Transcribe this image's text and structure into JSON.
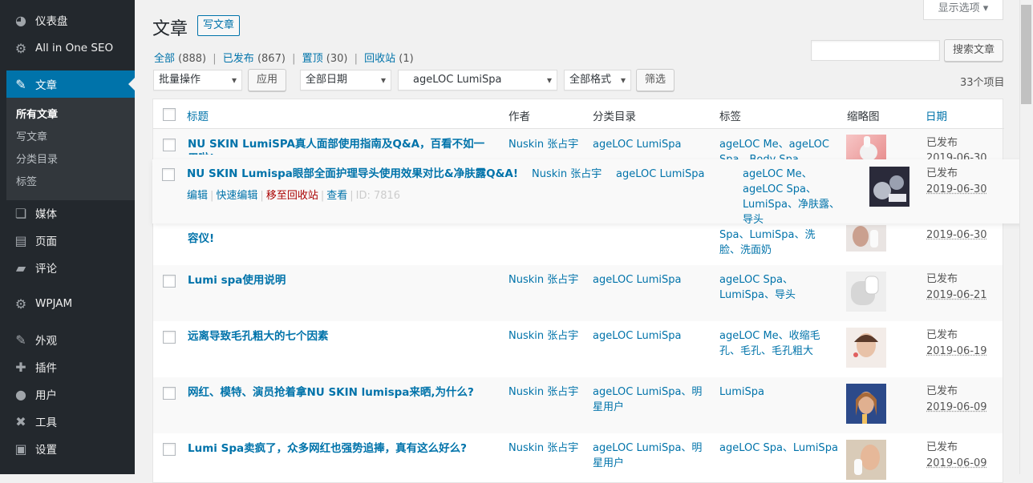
{
  "sidebar": {
    "items": [
      {
        "name": "dashboard",
        "label": "仪表盘",
        "icon": "gauge-icon",
        "glyph": "◕"
      },
      {
        "name": "seo",
        "label": "All in One SEO",
        "icon": "gear-icon",
        "glyph": "⚙"
      },
      {
        "name": "posts",
        "label": "文章",
        "icon": "pin-icon",
        "glyph": "✎"
      },
      {
        "name": "media",
        "label": "媒体",
        "icon": "media-icon",
        "glyph": "❏"
      },
      {
        "name": "pages",
        "label": "页面",
        "icon": "page-icon",
        "glyph": "▤"
      },
      {
        "name": "comments",
        "label": "评论",
        "icon": "comment-icon",
        "glyph": "▰"
      },
      {
        "name": "wpjam",
        "label": "WPJAM",
        "icon": "wpjam-icon",
        "glyph": "⚙"
      },
      {
        "name": "appearance",
        "label": "外观",
        "icon": "brush-icon",
        "glyph": "✎"
      },
      {
        "name": "plugins",
        "label": "插件",
        "icon": "plugin-icon",
        "glyph": "✚"
      },
      {
        "name": "users",
        "label": "用户",
        "icon": "user-icon",
        "glyph": "●"
      },
      {
        "name": "tools",
        "label": "工具",
        "icon": "wrench-icon",
        "glyph": "✖"
      },
      {
        "name": "settings",
        "label": "设置",
        "icon": "settings-icon",
        "glyph": "▣"
      }
    ],
    "submenu": [
      "所有文章",
      "写文章",
      "分类目录",
      "标签"
    ]
  },
  "header": {
    "title": "文章",
    "add_new": "写文章",
    "screen_options": "显示选项 ▾"
  },
  "views": {
    "all": "全部",
    "all_count": "(888)",
    "published": "已发布",
    "published_count": "(867)",
    "sticky": "置顶",
    "sticky_count": "(30)",
    "trash": "回收站",
    "trash_count": "(1)"
  },
  "search": {
    "button": "搜索文章",
    "value": ""
  },
  "filters": {
    "bulk": "批量操作",
    "apply": "应用",
    "dates": "全部日期",
    "category": "ageLOC LumiSpa",
    "formats": "全部格式",
    "filter": "筛选",
    "count": "33个项目"
  },
  "table": {
    "columns": {
      "title": "标题",
      "author": "作者",
      "categories": "分类目录",
      "tags": "标签",
      "thumbnail": "缩略图",
      "date": "日期"
    },
    "rows": [
      {
        "title": "NU SKIN LumiSPA真人面部使用指南及Q&A，百看不如一用啦!",
        "author": "Nuskin 张占宇",
        "categories": "ageLOC LumiSpa",
        "tags": "ageLOC Me、ageLOC Spa、Body Spa",
        "status": "已发布",
        "date": "2019-06-30"
      },
      {
        "title": "NU SKIN Lumispa眼部全面护理导头使用效果对比&净肤露Q&A!",
        "author": "Nuskin 张占宇",
        "categories": "ageLOC LumiSpa",
        "tags": "ageLOC Me、ageLOC Spa、LumiSpa、净肤露、导头",
        "status": "已发布",
        "date": "2019-06-30",
        "actions": {
          "edit": "编辑",
          "quick": "快速编辑",
          "trash": "移至回收站",
          "view": "查看",
          "id": "ID: 7816"
        }
      },
      {
        "title": "容仪!",
        "author": "",
        "categories": "",
        "tags": "Spa、LumiSpa、洗脸、洗面奶",
        "status": "",
        "date": "2019-06-30"
      },
      {
        "title": "Lumi spa使用说明",
        "author": "Nuskin 张占宇",
        "categories": "ageLOC LumiSpa",
        "tags": "ageLOC Spa、LumiSpa、导头",
        "status": "已发布",
        "date": "2019-06-21"
      },
      {
        "title": "远离导致毛孔粗大的七个因素",
        "author": "Nuskin 张占宇",
        "categories": "ageLOC LumiSpa",
        "tags": "ageLOC Me、收缩毛孔、毛孔、毛孔粗大",
        "status": "已发布",
        "date": "2019-06-19"
      },
      {
        "title": "网红、模特、演员抢着拿NU SKIN lumispa来晒,为什么?",
        "author": "Nuskin 张占宇",
        "categories": "ageLOC LumiSpa、明星用户",
        "tags": "LumiSpa",
        "status": "已发布",
        "date": "2019-06-09"
      },
      {
        "title": "Lumi Spa卖疯了，众多网红也强势追捧，真有这么好么?",
        "author": "Nuskin 张占宇",
        "categories": "ageLOC LumiSpa、明星用户",
        "tags": "ageLOC Spa、LumiSpa",
        "status": "已发布",
        "date": "2019-06-09"
      }
    ]
  },
  "colors": {
    "sidebar": "#23282d",
    "accent": "#0073aa",
    "trash": "#a00000"
  }
}
